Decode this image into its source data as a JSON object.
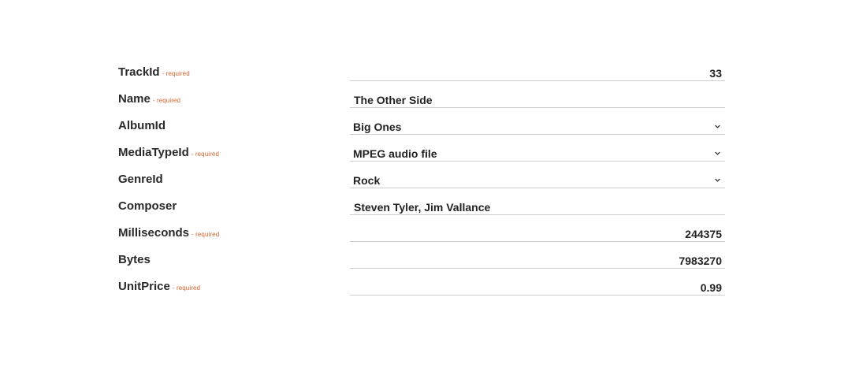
{
  "required_text": "- required",
  "fields": [
    {
      "label": "TrackId",
      "value": "33"
    },
    {
      "label": "Name",
      "value": "The Other Side"
    },
    {
      "label": "AlbumId",
      "value": "Big Ones"
    },
    {
      "label": "MediaTypeId",
      "value": "MPEG audio file"
    },
    {
      "label": "GenreId",
      "value": "Rock"
    },
    {
      "label": "Composer",
      "value": "Steven Tyler, Jim Vallance"
    },
    {
      "label": "Milliseconds",
      "value": "244375"
    },
    {
      "label": "Bytes",
      "value": "7983270"
    },
    {
      "label": "UnitPrice",
      "value": "0.99"
    }
  ],
  "icons": {
    "dropdown": "chevron-down-icon"
  },
  "colors": {
    "required": "#d2622e",
    "underline": "#cfcfcf",
    "text": "#222222"
  }
}
